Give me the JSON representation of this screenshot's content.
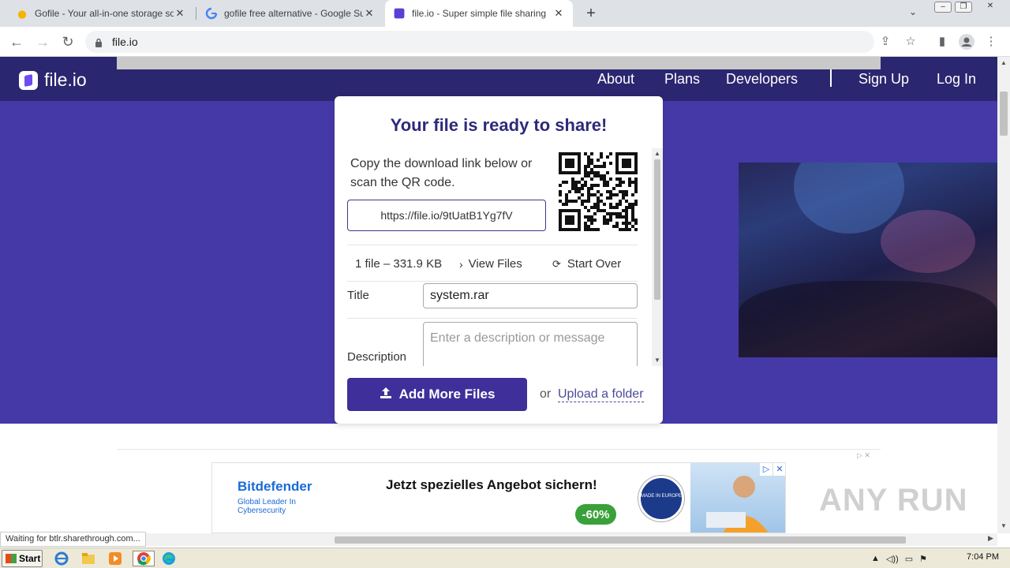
{
  "browser": {
    "tabs": [
      {
        "title": "Gofile - Your all-in-one storage soluti",
        "active": false
      },
      {
        "title": "gofile free alternative - Google Such",
        "active": false
      },
      {
        "title": "file.io - Super simple file sharing",
        "active": true
      }
    ],
    "new_tab": "+",
    "address": "file.io"
  },
  "site": {
    "logo": "file.io",
    "nav": [
      "About",
      "Plans",
      "Developers"
    ],
    "auth": [
      "Sign Up",
      "Log In"
    ]
  },
  "card": {
    "title": "Your file is ready to share!",
    "instructions": "Copy the download link below or scan the QR code.",
    "link": "https://file.io/9tUatB1Yg7fV",
    "file_summary": "1 file – 331.9 KB",
    "view_files": "View Files",
    "start_over": "Start Over",
    "title_label": "Title",
    "title_value": "system.rar",
    "description_label": "Description",
    "description_placeholder": "Enter a description or message",
    "add_more": "Add More Files",
    "or": "or",
    "upload_folder": "Upload a folder"
  },
  "ad": {
    "brand": "Bitdefender",
    "tagline": "Global Leader In Cybersecurity",
    "headline": "Jetzt spezielles Angebot sichern!",
    "discount": "-60%",
    "seal_text": "MADE IN EUROPE"
  },
  "status_text": "Waiting for btlr.sharethrough.com...",
  "watermark": "ANY RUN",
  "taskbar": {
    "start": "Start",
    "clock": "7:04 PM"
  },
  "colors": {
    "hero": "#4539a8",
    "header": "#2b2670",
    "accent": "#3e2f9a",
    "title": "#2e2a7a"
  }
}
